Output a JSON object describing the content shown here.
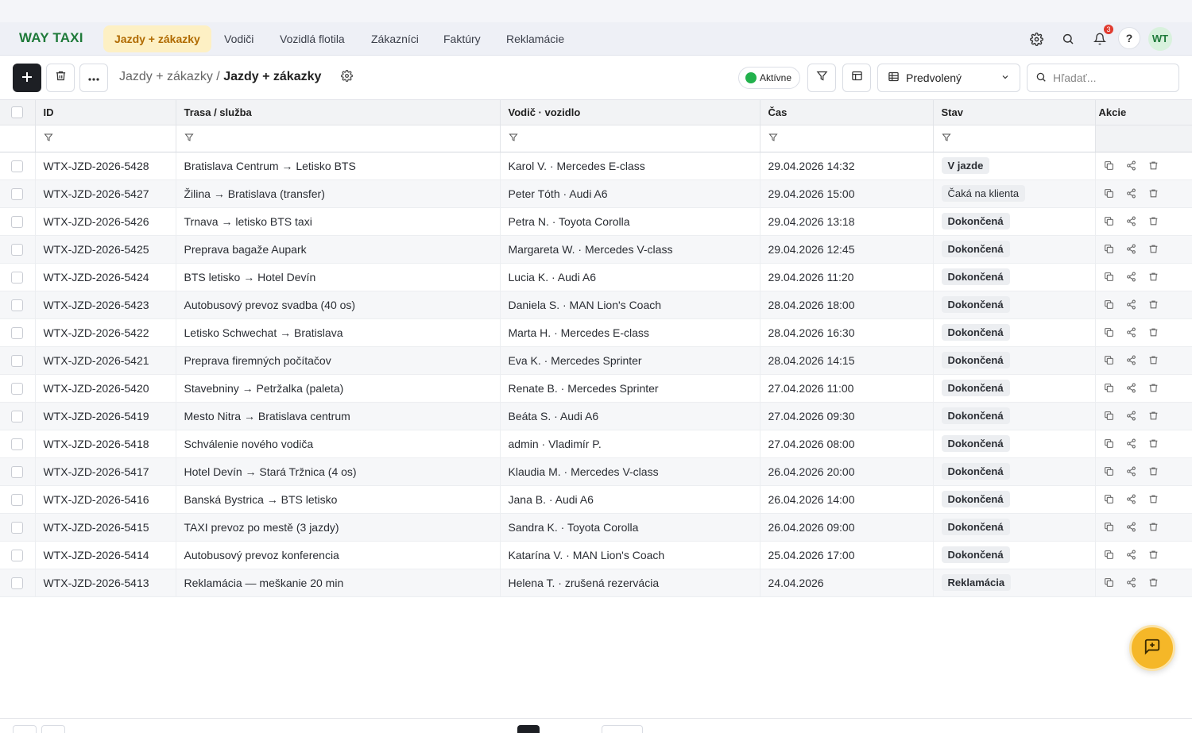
{
  "brand": "WAY TAXI",
  "nav": {
    "items": [
      {
        "label": "Jazdy + zákazky",
        "active": true
      },
      {
        "label": "Vodiči",
        "active": false
      },
      {
        "label": "Vozidlá flotila",
        "active": false
      },
      {
        "label": "Zákazníci",
        "active": false
      },
      {
        "label": "Faktúry",
        "active": false
      },
      {
        "label": "Reklamácie",
        "active": false
      }
    ],
    "notifications_count": "3",
    "help_label": "?",
    "user_initials": "WT"
  },
  "toolbar": {
    "breadcrumb_parent": "Jazdy + zákazky",
    "breadcrumb_separator": "/",
    "breadcrumb_current": "Jazdy + zákazky",
    "status_label": "Aktívne",
    "view_selected": "Predvolený",
    "search_placeholder": "Hľadať..."
  },
  "table": {
    "columns": [
      "ID",
      "Trasa / služba",
      "Vodič · vozidlo",
      "Čas",
      "Stav",
      "Akcie"
    ],
    "rows": [
      {
        "id": "WTX-JZD-2026-5428",
        "route": "Bratislava Centrum → Letisko BTS",
        "driver": "Karol V. · Mercedes E-class",
        "time": "29.04.2026 14:32",
        "status": "V jazde",
        "status_style": "bold"
      },
      {
        "id": "WTX-JZD-2026-5427",
        "route": "Žilina → Bratislava (transfer)",
        "driver": "Peter Tóth · Audi A6",
        "time": "29.04.2026 15:00",
        "status": "Čaká na klienta",
        "status_style": "plain"
      },
      {
        "id": "WTX-JZD-2026-5426",
        "route": "Trnava → letisko BTS taxi",
        "driver": "Petra N. · Toyota Corolla",
        "time": "29.04.2026 13:18",
        "status": "Dokončená",
        "status_style": "bold"
      },
      {
        "id": "WTX-JZD-2026-5425",
        "route": "Preprava bagaže Aupark",
        "driver": "Margareta W. · Mercedes V-class",
        "time": "29.04.2026 12:45",
        "status": "Dokončená",
        "status_style": "bold"
      },
      {
        "id": "WTX-JZD-2026-5424",
        "route": "BTS letisko → Hotel Devín",
        "driver": "Lucia K. · Audi A6",
        "time": "29.04.2026 11:20",
        "status": "Dokončená",
        "status_style": "bold"
      },
      {
        "id": "WTX-JZD-2026-5423",
        "route": "Autobusový prevoz svadba (40 os)",
        "driver": "Daniela S. · MAN Lion's Coach",
        "time": "28.04.2026 18:00",
        "status": "Dokončená",
        "status_style": "bold"
      },
      {
        "id": "WTX-JZD-2026-5422",
        "route": "Letisko Schwechat → Bratislava",
        "driver": "Marta H. · Mercedes E-class",
        "time": "28.04.2026 16:30",
        "status": "Dokončená",
        "status_style": "bold"
      },
      {
        "id": "WTX-JZD-2026-5421",
        "route": "Preprava firemných počítačov",
        "driver": "Eva K. · Mercedes Sprinter",
        "time": "28.04.2026 14:15",
        "status": "Dokončená",
        "status_style": "bold"
      },
      {
        "id": "WTX-JZD-2026-5420",
        "route": "Stavebniny → Petržalka (paleta)",
        "driver": "Renate B. · Mercedes Sprinter",
        "time": "27.04.2026 11:00",
        "status": "Dokončená",
        "status_style": "bold"
      },
      {
        "id": "WTX-JZD-2026-5419",
        "route": "Mesto Nitra → Bratislava centrum",
        "driver": "Beáta S. · Audi A6",
        "time": "27.04.2026 09:30",
        "status": "Dokončená",
        "status_style": "bold"
      },
      {
        "id": "WTX-JZD-2026-5418",
        "route": "Schválenie nového vodiča",
        "driver": "admin · Vladimír P.",
        "time": "27.04.2026 08:00",
        "status": "Dokončená",
        "status_style": "bold"
      },
      {
        "id": "WTX-JZD-2026-5417",
        "route": "Hotel Devín → Stará Tržnica (4 os)",
        "driver": "Klaudia M. · Mercedes V-class",
        "time": "26.04.2026 20:00",
        "status": "Dokončená",
        "status_style": "bold"
      },
      {
        "id": "WTX-JZD-2026-5416",
        "route": "Banská Bystrica → BTS letisko",
        "driver": "Jana B. · Audi A6",
        "time": "26.04.2026 14:00",
        "status": "Dokončená",
        "status_style": "bold"
      },
      {
        "id": "WTX-JZD-2026-5415",
        "route": "TAXI prevoz po mestě (3 jazdy)",
        "driver": "Sandra K. · Toyota Corolla",
        "time": "26.04.2026 09:00",
        "status": "Dokončená",
        "status_style": "bold"
      },
      {
        "id": "WTX-JZD-2026-5414",
        "route": "Autobusový prevoz konferencia",
        "driver": "Katarína V. · MAN Lion's Coach",
        "time": "25.04.2026 17:00",
        "status": "Dokončená",
        "status_style": "bold"
      },
      {
        "id": "WTX-JZD-2026-5413",
        "route": "Reklamácia — meškanie 20 min",
        "driver": "Helena T. · zrušená rezervácia",
        "time": "24.04.2026",
        "status": "Reklamácia",
        "status_style": "bold"
      }
    ]
  },
  "colors": {
    "brand": "#1f7a3a",
    "active_tab_bg": "#fdf0c4",
    "active_tab_text": "#b06a00",
    "fab": "#f5b728",
    "status_active": "#22b14c",
    "notification_badge": "#e03b2f"
  },
  "icons": {
    "settings": "gear-icon",
    "search": "search-icon",
    "notifications": "bell-icon",
    "add": "plus-icon",
    "delete": "trash-icon",
    "more": "ellipsis-icon",
    "filter": "filter-icon",
    "columns": "columns-icon",
    "view": "table-icon",
    "copy": "copy-icon",
    "share": "share-icon",
    "feedback": "message-plus-icon"
  }
}
